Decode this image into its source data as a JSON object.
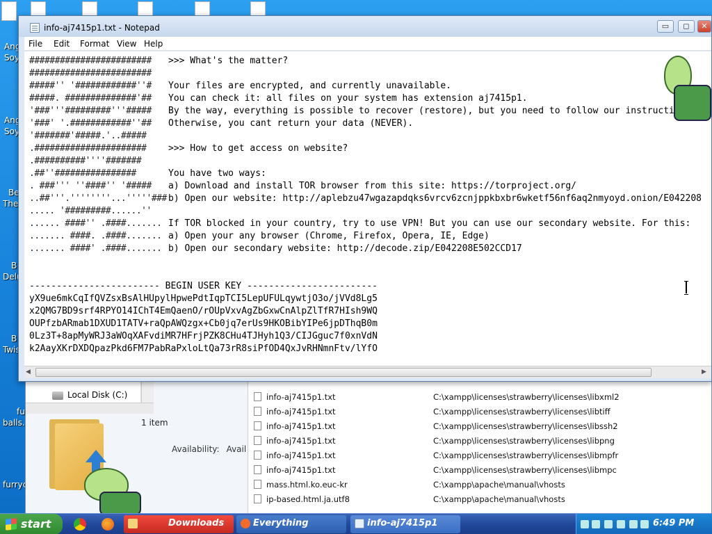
{
  "desktop": {
    "labels": [
      "Ang",
      "Soy",
      "Ang",
      "Soy",
      "Be",
      "The",
      "B",
      "Delu",
      "B",
      "Twis",
      "fu",
      "balls.",
      "furryc"
    ]
  },
  "notepad": {
    "title": "info-aj7415p1.txt - Notepad",
    "window_buttons": {
      "minimize": "▭",
      "maximize": "◻",
      "close": "✕"
    },
    "menu": [
      "File",
      "Edit",
      "Format",
      "View",
      "Help"
    ],
    "ascii_art": [
      "########################",
      "########################",
      "#####'' '############''#",
      "#####. ##############'##",
      "'###'''#########'''#####",
      "'###' '.############''##",
      "'#######'#####.'..#####",
      ".######################",
      ".##########''''#######",
      ".##''################",
      ". ###''' ''####'' '#####",
      "..##'''.''''''''...'''''###",
      "..... '#########......''",
      "...... ####'' .####.......",
      "....... ####. .####.......",
      "....... ####' .####......."
    ],
    "lines": [
      ">>> What's the matter?",
      "",
      "Your files are encrypted, and currently unavailable.",
      "You can check it: all files on your system has extension aj7415p1.",
      "By the way, everything is possible to recover (restore), but you need to follow our instructions.",
      "Otherwise, you cant return your data (NEVER).",
      "",
      ">>> How to get access on website?",
      "",
      "You have two ways:",
      "a) Download and install TOR browser from this site: https://torproject.org/",
      "b) Open our website: http://aplebzu47wgazapdqks6vrcv6zcnjppkbxbr6wketf56nf6aq2nmyoyd.onion/E042208",
      "",
      "If TOR blocked in your country, try to use VPN! But you can use our secondary website. For this:",
      "a) Open your any browser (Chrome, Firefox, Opera, IE, Edge)",
      "b) Open our secondary website: http://decode.zip/E042208E502CCD17"
    ],
    "key_header": "------------------------ BEGIN USER KEY ------------------------",
    "key_lines": [
      "yX9ue6mkCqIfQVZsxBsAlHUpylHpwePdtIqpTCI5LepUFULqywtjO3o/jVVd8Lg5",
      "x2QMG7BD9srf4RPYO14IChT4EmQaenO/rOUpVxvAgZbGxwCnAlpZlTfR7HIsh9WQ",
      "OUPfzbARmab1DXUD1TATV+raQpAWQzgx+Cb0jq7erUs9HKOBibYIPe6jpDThqB0m",
      "0Lz3T+8apMyWRJ3aWOqXAFvdiMR7HFrjPZK8CHu4TJHyh1Q3/CIJGguc7f0xnVdN",
      "k2AayXKrDXDQpazPkd6FM7PabRaPxloLtQa73rR8siPfOD4QxJvRHNmnFtv/lYfO"
    ]
  },
  "explorer": {
    "nav_item": "Local Disk (C:)",
    "items_count": "1 item",
    "availability_label": "Availability:",
    "availability_value": "Avail",
    "files": [
      {
        "name": "info-aj7415p1.txt",
        "path": "C:\\xampp\\licenses\\strawberry\\licenses\\libxml2"
      },
      {
        "name": "info-aj7415p1.txt",
        "path": "C:\\xampp\\licenses\\strawberry\\licenses\\libtiff"
      },
      {
        "name": "info-aj7415p1.txt",
        "path": "C:\\xampp\\licenses\\strawberry\\licenses\\libssh2"
      },
      {
        "name": "info-aj7415p1.txt",
        "path": "C:\\xampp\\licenses\\strawberry\\licenses\\libpng"
      },
      {
        "name": "info-aj7415p1.txt",
        "path": "C:\\xampp\\licenses\\strawberry\\licenses\\libmpfr"
      },
      {
        "name": "info-aj7415p1.txt",
        "path": "C:\\xampp\\licenses\\strawberry\\licenses\\libmpc"
      },
      {
        "name": "mass.html.ko.euc-kr",
        "path": "C:\\xampp\\apache\\manual\\vhosts"
      },
      {
        "name": "ip-based.html.ja.utf8",
        "path": "C:\\xampp\\apache\\manual\\vhosts"
      }
    ]
  },
  "taskbar": {
    "start_label": "start",
    "tasks": [
      {
        "label": "Downloads",
        "color": "#d9302a"
      },
      {
        "label": "Everything",
        "color": "#2c5fb0"
      },
      {
        "label": "info-aj7415p1",
        "color": "#3a6fc4"
      }
    ],
    "clock": "6:49 PM"
  },
  "colors": {
    "desktop": "#1a8fe0",
    "taskbar": "#224a9c",
    "start": "#2f8a2f"
  }
}
